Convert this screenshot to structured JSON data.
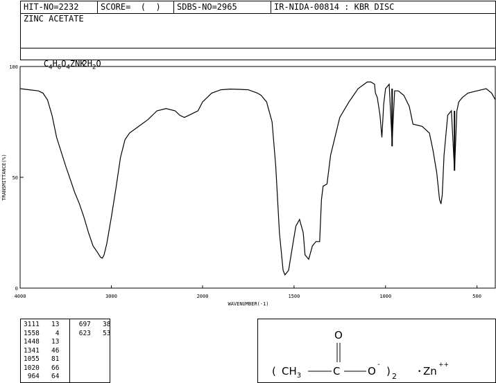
{
  "header": {
    "hit_no": "HIT-NO=2232",
    "score": "SCORE=  (  )",
    "sdbs_no": "SDBS-NO=2965",
    "ir_id": "IR-NIDA-00814 : KBR DISC"
  },
  "compound": {
    "name": "ZINC ACETATE",
    "formula": {
      "c": "C",
      "c_n": "4",
      "h": "H",
      "h_n": "6",
      "o": "O",
      "o_n": "4",
      "rest": "ZN",
      "k": "K",
      "h2": "2H",
      "h2_n": "2",
      "o2": "O"
    }
  },
  "chart_data": {
    "type": "line",
    "xlabel": "WAVENUMBER(-1)",
    "ylabel": "TRANSMITTANCE(%)",
    "xlim": [
      4000,
      400
    ],
    "ylim": [
      0,
      100
    ],
    "x_ticks": [
      "4000",
      "3000",
      "2000",
      "1500",
      "1000",
      "500"
    ],
    "y_ticks": [
      "100",
      "50",
      "0"
    ],
    "series": [
      {
        "x": [
          4000,
          3900,
          3800,
          3750,
          3700,
          3650,
          3600,
          3500,
          3400,
          3350,
          3300,
          3250,
          3200,
          3150,
          3120,
          3100,
          3080,
          3050,
          3000,
          2950,
          2900,
          2850,
          2800,
          2700,
          2600,
          2500,
          2400,
          2300,
          2250,
          2200,
          2150,
          2100,
          2050,
          2000,
          1950,
          1900,
          1850,
          1800,
          1750,
          1700,
          1680,
          1650,
          1620,
          1600,
          1580,
          1560,
          1550,
          1530,
          1510,
          1490,
          1470,
          1450,
          1440,
          1420,
          1400,
          1380,
          1360,
          1350,
          1341,
          1320,
          1300,
          1250,
          1200,
          1150,
          1100,
          1080,
          1060,
          1055,
          1045,
          1030,
          1020,
          1010,
          1000,
          980,
          964,
          950,
          930,
          900,
          870,
          850,
          800,
          760,
          740,
          720,
          705,
          697,
          690,
          680,
          660,
          640,
          623,
          610,
          600,
          580,
          550,
          500,
          450,
          420,
          400
        ],
        "y": [
          90,
          89.5,
          89,
          88,
          85,
          78,
          68,
          55,
          43,
          38,
          32,
          25,
          19,
          16,
          14,
          13.5,
          15,
          20,
          32,
          45,
          59,
          67,
          70,
          73,
          76,
          80,
          81,
          80,
          78,
          77,
          78,
          79,
          80,
          84,
          88,
          89.5,
          89.8,
          89.7,
          89.5,
          88,
          87,
          84,
          75,
          55,
          25,
          8,
          6,
          8,
          18,
          28,
          31,
          25,
          15,
          13,
          19,
          21,
          21,
          40,
          46,
          47,
          60,
          77,
          84,
          90,
          93,
          93,
          92,
          88,
          86,
          78,
          68,
          83,
          90,
          92,
          66,
          89,
          89,
          87,
          82,
          74,
          73,
          70,
          62,
          52,
          40,
          38,
          42,
          60,
          78,
          80,
          53,
          80,
          84,
          86,
          88,
          89,
          90,
          88,
          85
        ]
      }
    ]
  },
  "peaks": [
    [
      "3111",
      "13"
    ],
    [
      "1558",
      "4"
    ],
    [
      "1448",
      "13"
    ],
    [
      "1341",
      "46"
    ],
    [
      "1055",
      "81"
    ],
    [
      "1020",
      "66"
    ],
    [
      "964",
      "64"
    ],
    [
      "697",
      "38"
    ],
    [
      "623",
      "53"
    ]
  ],
  "structure": {
    "paren_open": "(",
    "ch": "CH",
    "ch_sub": "3",
    "carbon": "C",
    "oxygen_top": "O",
    "oxygen": "O",
    "charge": "-",
    "paren_close": ")",
    "count": "2",
    "dot": "•",
    "zn": "Zn",
    "zn_charge": "++"
  }
}
